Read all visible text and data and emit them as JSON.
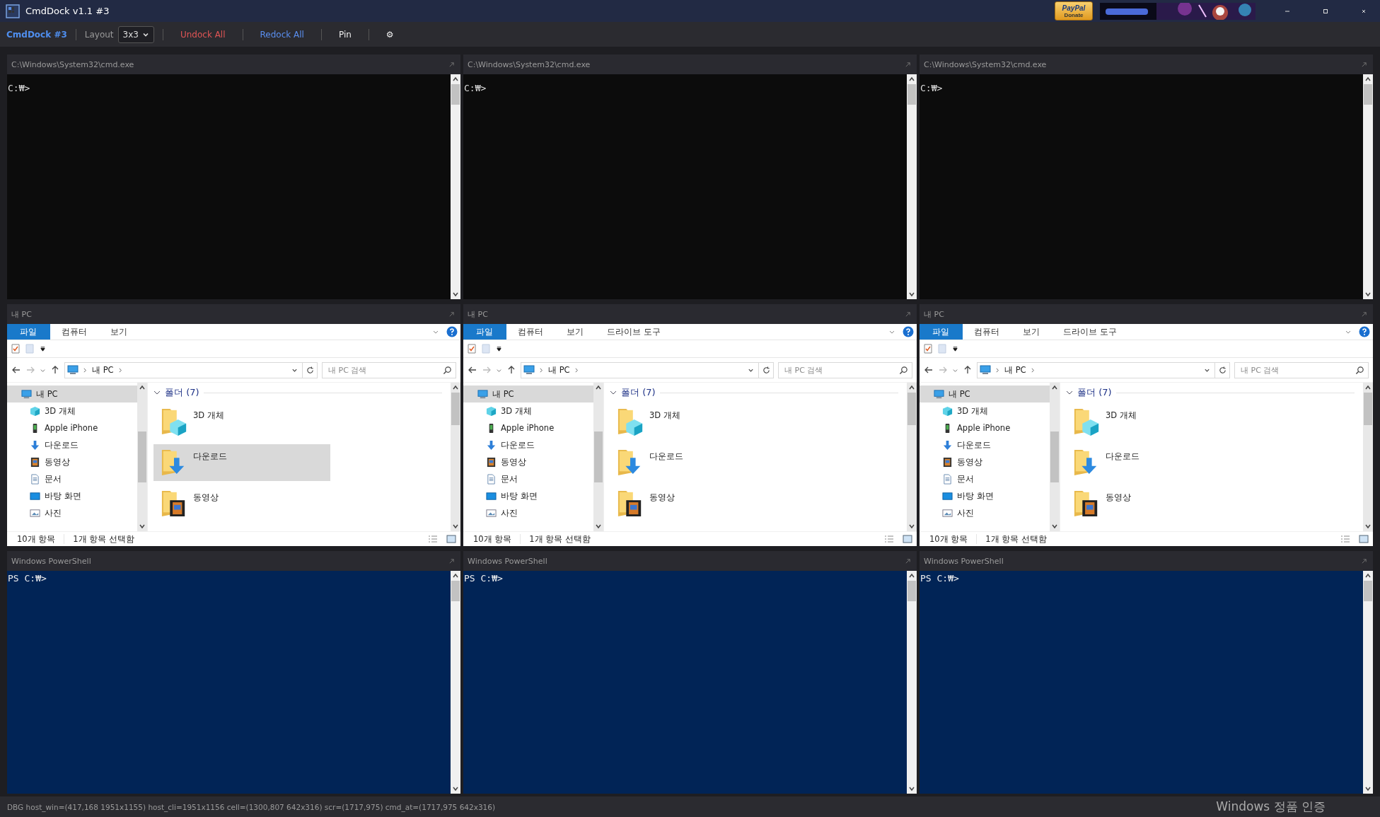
{
  "window": {
    "title": "CmdDock v1.1 #3",
    "donate": {
      "brand": "PayPal",
      "label": "Donate"
    }
  },
  "toolbar": {
    "brand": "CmdDock #3",
    "layout_label": "Layout",
    "layout_value": "3x3",
    "buttons": [
      {
        "label": "Undock All",
        "kind": "danger"
      },
      {
        "label": "Redock All",
        "kind": "primary"
      },
      {
        "label": "Pin",
        "kind": "plain"
      },
      {
        "label": "⚙",
        "kind": "plain"
      }
    ]
  },
  "panels": [
    {
      "kind": "cmd",
      "title": "C:\\Windows\\System32\\cmd.exe",
      "prompt": "C:₩>"
    },
    {
      "kind": "cmd",
      "title": "C:\\Windows\\System32\\cmd.exe",
      "prompt": "C:₩>"
    },
    {
      "kind": "cmd",
      "title": "C:\\Windows\\System32\\cmd.exe",
      "prompt": "C:₩>"
    },
    {
      "kind": "explorer",
      "title": "내 PC",
      "ribbon_tabs": [
        {
          "label": "파일",
          "selected": true
        },
        {
          "label": "컴퓨터",
          "selected": false
        },
        {
          "label": "보기",
          "selected": false
        }
      ],
      "path": "내 PC",
      "search_placeholder": "내 PC 검색",
      "nav_items": [
        {
          "label": "내 PC",
          "kind": "pc",
          "selected": true,
          "children": [
            {
              "label": "3D 개체",
              "kind": "cube",
              "selected": false
            },
            {
              "label": "Apple iPhone",
              "kind": "phone",
              "selected": false
            },
            {
              "label": "다운로드",
              "kind": "download",
              "selected": false
            },
            {
              "label": "동영상",
              "kind": "video",
              "selected": false
            },
            {
              "label": "문서",
              "kind": "document",
              "selected": false
            },
            {
              "label": "바탕 화면",
              "kind": "desktop",
              "selected": false
            },
            {
              "label": "사진",
              "kind": "pictures",
              "selected": false
            }
          ]
        }
      ],
      "group": "폴더 (7)",
      "folders": [
        {
          "name": "3D 개체",
          "kind": "cube",
          "selected": false
        },
        {
          "name": "다운로드",
          "kind": "download",
          "selected": true
        },
        {
          "name": "동영상",
          "kind": "video",
          "selected": false
        }
      ],
      "item_count": "10개 항목",
      "selection_count": "1개 항목 선택함"
    },
    {
      "kind": "explorer",
      "title": "내 PC",
      "ribbon_tabs": [
        {
          "label": "파일",
          "selected": true
        },
        {
          "label": "컴퓨터",
          "selected": false
        },
        {
          "label": "보기",
          "selected": false
        },
        {
          "label": "드라이브 도구",
          "selected": false
        }
      ],
      "path": "내 PC",
      "search_placeholder": "내 PC 검색",
      "nav_items": [
        {
          "label": "내 PC",
          "kind": "pc",
          "selected": true,
          "children": [
            {
              "label": "3D 개체",
              "kind": "cube",
              "selected": false
            },
            {
              "label": "Apple iPhone",
              "kind": "phone",
              "selected": false
            },
            {
              "label": "다운로드",
              "kind": "download",
              "selected": false
            },
            {
              "label": "동영상",
              "kind": "video",
              "selected": false
            },
            {
              "label": "문서",
              "kind": "document",
              "selected": false
            },
            {
              "label": "바탕 화면",
              "kind": "desktop",
              "selected": false
            },
            {
              "label": "사진",
              "kind": "pictures",
              "selected": false
            }
          ]
        }
      ],
      "group": "폴더 (7)",
      "folders": [
        {
          "name": "3D 개체",
          "kind": "cube",
          "selected": false
        },
        {
          "name": "다운로드",
          "kind": "download",
          "selected": false
        },
        {
          "name": "동영상",
          "kind": "video",
          "selected": false
        }
      ],
      "item_count": "10개 항목",
      "selection_count": "1개 항목 선택함"
    },
    {
      "kind": "explorer",
      "title": "내 PC",
      "ribbon_tabs": [
        {
          "label": "파일",
          "selected": true
        },
        {
          "label": "컴퓨터",
          "selected": false
        },
        {
          "label": "보기",
          "selected": false
        },
        {
          "label": "드라이브 도구",
          "selected": false
        }
      ],
      "path": "내 PC",
      "search_placeholder": "내 PC 검색",
      "nav_items": [
        {
          "label": "내 PC",
          "kind": "pc",
          "selected": true,
          "children": [
            {
              "label": "3D 개체",
              "kind": "cube",
              "selected": false
            },
            {
              "label": "Apple iPhone",
              "kind": "phone",
              "selected": false
            },
            {
              "label": "다운로드",
              "kind": "download",
              "selected": false
            },
            {
              "label": "동영상",
              "kind": "video",
              "selected": false
            },
            {
              "label": "문서",
              "kind": "document",
              "selected": false
            },
            {
              "label": "바탕 화면",
              "kind": "desktop",
              "selected": false
            },
            {
              "label": "사진",
              "kind": "pictures",
              "selected": false
            }
          ]
        }
      ],
      "group": "폴더 (7)",
      "folders": [
        {
          "name": "3D 개체",
          "kind": "cube",
          "selected": false
        },
        {
          "name": "다운로드",
          "kind": "download",
          "selected": false
        },
        {
          "name": "동영상",
          "kind": "video",
          "selected": false
        }
      ],
      "item_count": "10개 항목",
      "selection_count": "1개 항목 선택함"
    },
    {
      "kind": "powershell",
      "title": "Windows PowerShell",
      "prompt": "PS C:₩>"
    },
    {
      "kind": "powershell",
      "title": "Windows PowerShell",
      "prompt": "PS C:₩>"
    },
    {
      "kind": "powershell",
      "title": "Windows PowerShell",
      "prompt": "PS C:₩>"
    }
  ],
  "status_bar": "DBG host_win=(417,168 1951x1155) host_cli=1951x1156 cell=(1300,807 642x316) scr=(1717,975) cmd_at=(1717,975 642x316)",
  "activation_notice": "Windows 정품 인증"
}
